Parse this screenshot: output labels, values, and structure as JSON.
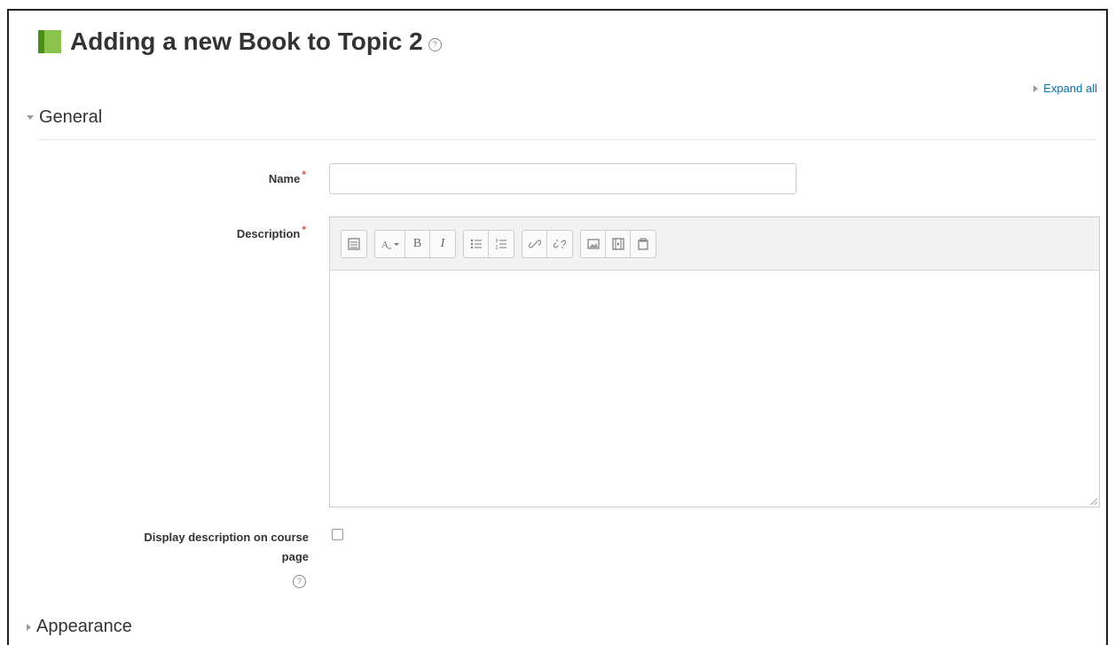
{
  "header": {
    "title": "Adding a new Book to Topic 2",
    "help_glyph": "?",
    "icon": "book-icon"
  },
  "expand_all": "Expand all",
  "sections": {
    "general": "General",
    "appearance": "Appearance"
  },
  "form": {
    "name_label": "Name",
    "name_value": "",
    "name_placeholder": "",
    "description_label": "Description",
    "required_marker": "*",
    "display_description_label_line1": "Display description on course",
    "display_description_label_line2": "page",
    "display_description_checked": false,
    "help_glyph": "?"
  },
  "toolbar": {
    "buttons": [
      "collapse-icon",
      "text-style-icon",
      "bold-icon",
      "italic-icon",
      "unordered-list-icon",
      "ordered-list-icon",
      "link-icon",
      "unlink-icon",
      "image-icon",
      "media-icon",
      "file-manager-icon"
    ],
    "bold_glyph": "B",
    "italic_glyph": "I"
  },
  "colors": {
    "link": "#0070a8",
    "required": "#d9534f",
    "book_green": "#8bc34a",
    "book_spine": "#4a8f1b"
  }
}
